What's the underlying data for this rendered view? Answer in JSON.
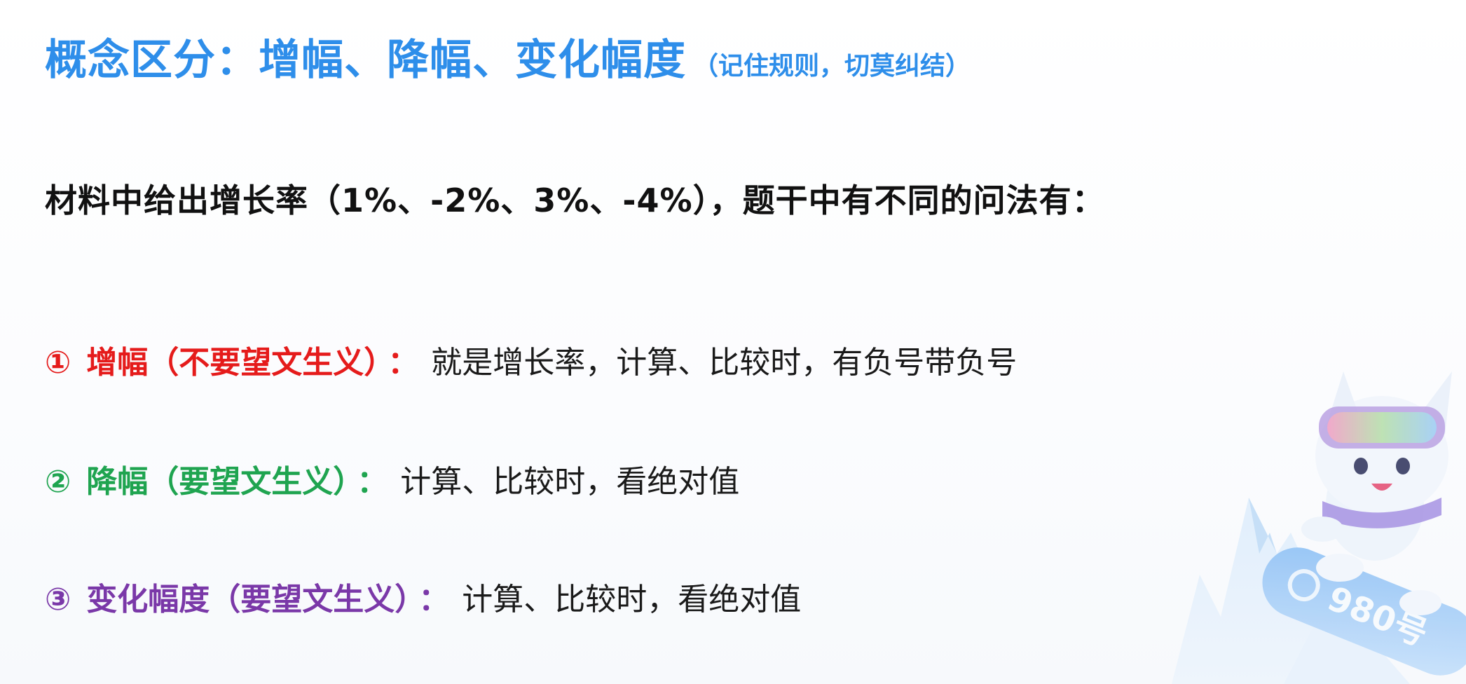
{
  "title": {
    "main": "概念区分：增幅、降幅、变化幅度",
    "note": "（记住规则，切莫纠结）"
  },
  "intro": "材料中给出增长率（1%、-2%、3%、-4%），题干中有不同的问法有：",
  "items": [
    {
      "number": "①",
      "term": "增幅（不要望文生义）",
      "colon": "：",
      "desc": "就是增长率，计算、比较时，有负号带负号",
      "color": "#e51b1b"
    },
    {
      "number": "②",
      "term": "降幅（要望文生义）",
      "colon": "：",
      "desc": "计算、比较时，看绝对值",
      "color": "#1fa450"
    },
    {
      "number": "③",
      "term": "变化幅度（要望文生义）",
      "colon": "：",
      "desc": "计算、比较时，看绝对值",
      "color": "#7a38a8"
    }
  ],
  "decor": {
    "mascot_badge": "980号",
    "icon": "mascot-snowboard-illustration"
  }
}
